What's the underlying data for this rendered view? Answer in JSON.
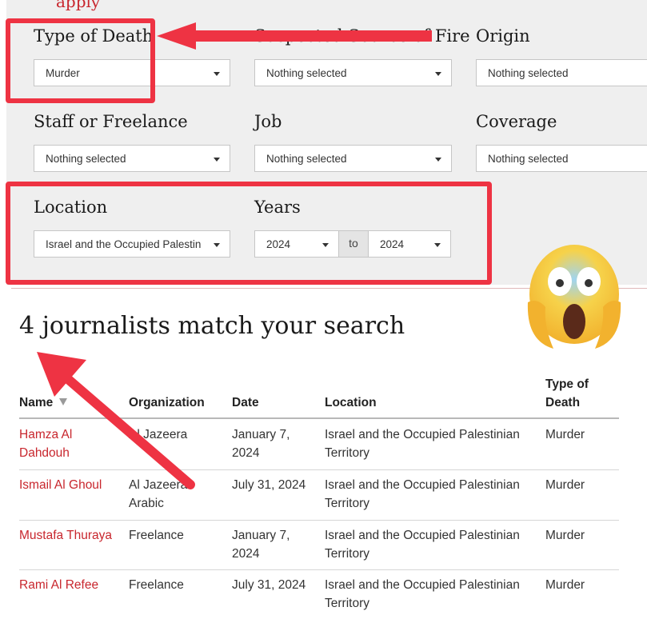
{
  "top_hint": "apply",
  "filters": {
    "type_of_death": {
      "label": "Type of Death",
      "value": "Murder"
    },
    "suspected_source": {
      "label": "Suspected Source of Fire",
      "value": "Nothing selected"
    },
    "origin": {
      "label": "Origin",
      "value": "Nothing selected"
    },
    "staff_or_freelance": {
      "label": "Staff or Freelance",
      "value": "Nothing selected"
    },
    "job": {
      "label": "Job",
      "value": "Nothing selected"
    },
    "coverage": {
      "label": "Coverage",
      "value": "Nothing selected"
    },
    "location": {
      "label": "Location",
      "value": "Israel and the Occupied Palestin"
    },
    "years": {
      "label": "Years",
      "from": "2024",
      "to_label": "to",
      "to": "2024"
    }
  },
  "results": {
    "headline": "4 journalists match your search",
    "columns": {
      "name": "Name",
      "organization": "Organization",
      "date": "Date",
      "location": "Location",
      "type_of_death_l1": "Type of",
      "type_of_death_l2": "Death"
    },
    "rows": [
      {
        "name_l1": "Hamza Al",
        "name_l2": "Dahdouh",
        "org_l1": "Al Jazeera",
        "org_l2": "",
        "date_l1": "January 7,",
        "date_l2": "2024",
        "loc_l1": "Israel and the Occupied Palestinian",
        "loc_l2": "Territory",
        "type": "Murder"
      },
      {
        "name_l1": "Ismail Al Ghoul",
        "name_l2": "",
        "org_l1": "Al Jazeera",
        "org_l2": "Arabic",
        "date_l1": "July 31, 2024",
        "date_l2": "",
        "loc_l1": "Israel and the Occupied Palestinian",
        "loc_l2": "Territory",
        "type": "Murder"
      },
      {
        "name_l1": "Mustafa Thuraya",
        "name_l2": "",
        "org_l1": "Freelance",
        "org_l2": "",
        "date_l1": "January 7,",
        "date_l2": "2024",
        "loc_l1": "Israel and the Occupied Palestinian",
        "loc_l2": "Territory",
        "type": "Murder"
      },
      {
        "name_l1": "Rami Al Refee",
        "name_l2": "",
        "org_l1": "Freelance",
        "org_l2": "",
        "date_l1": "July 31, 2024",
        "date_l2": "",
        "loc_l1": "Israel and the Occupied Palestinian",
        "loc_l2": "Territory",
        "type": "Murder"
      }
    ]
  },
  "annotations": {
    "highlight_color": "#ee3343",
    "emoji": "face-screaming-in-fear"
  },
  "colors": {
    "accent_red": "#c8262d",
    "panel_bg": "#efefef"
  }
}
